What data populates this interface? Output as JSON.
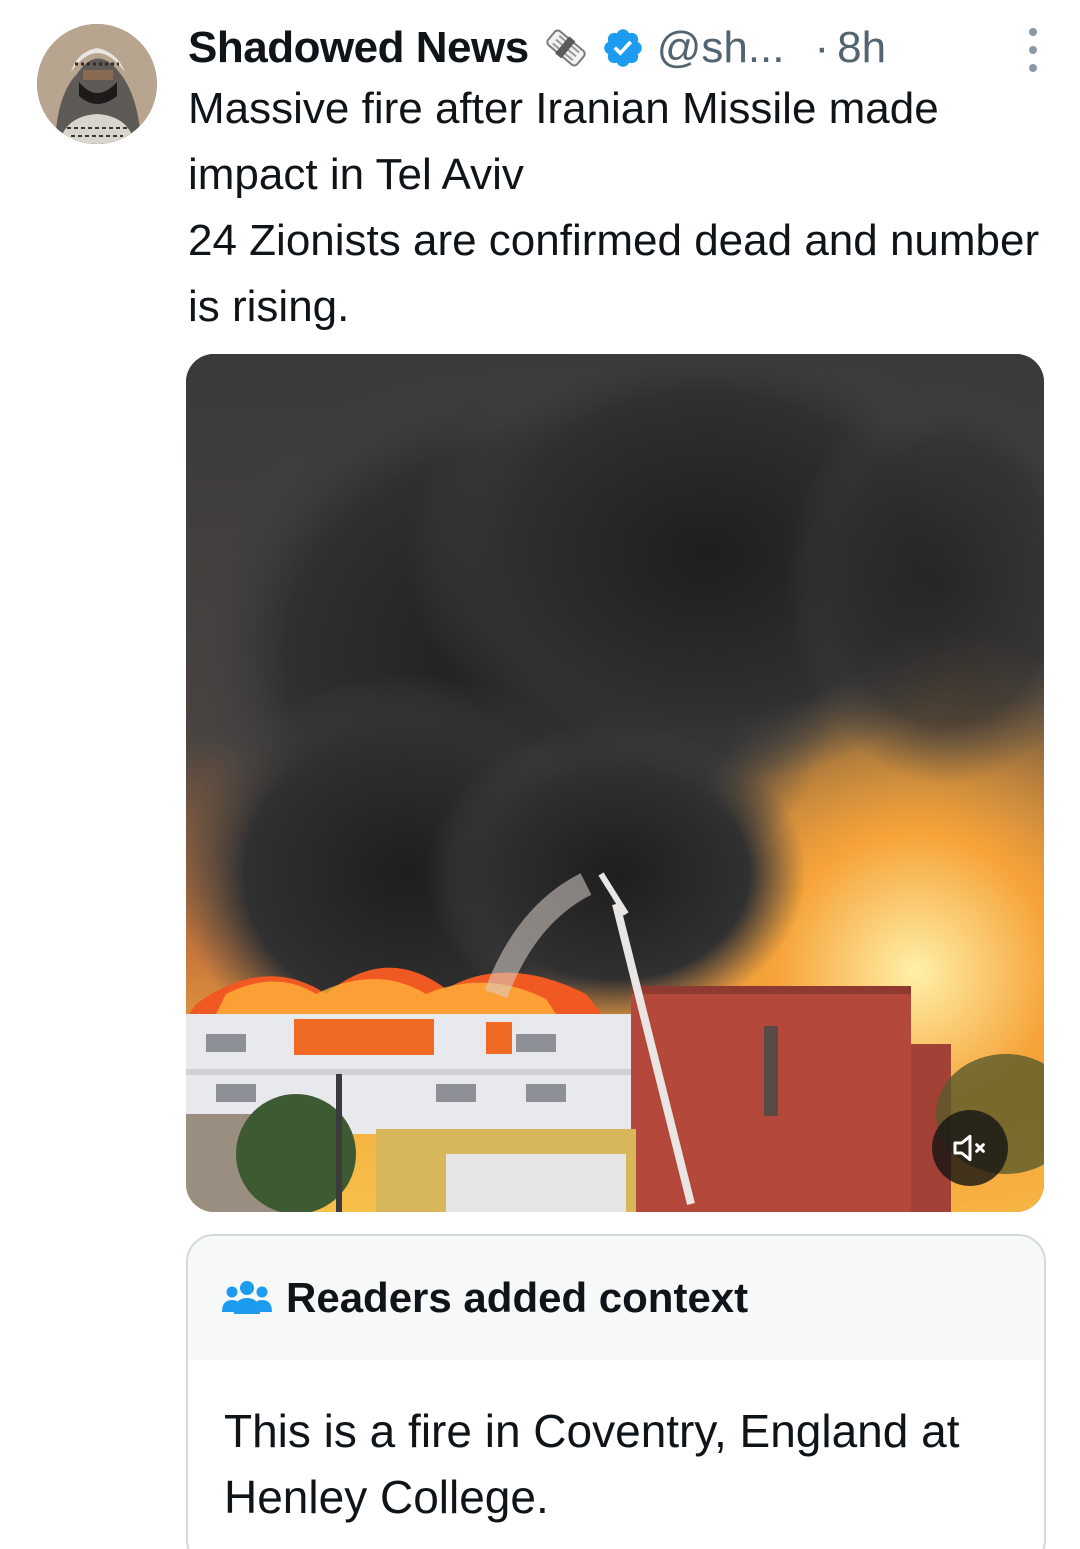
{
  "author": {
    "display_name": "Shadowed News",
    "name_emoji": "newspaper-roll-icon",
    "verified": true,
    "handle": "@sh...",
    "separator": "·",
    "time": "8h"
  },
  "tweet": {
    "lines": [
      "Massive fire after Iranian Missile made impact in Tel Aviv",
      "24 Zionists are confirmed dead and number is rising."
    ]
  },
  "media": {
    "type": "video",
    "description_icon": "mute-icon"
  },
  "context_note": {
    "title": "Readers added context",
    "body": "This is a fire in Coventry, England at Henley College."
  },
  "colors": {
    "text": "#0f1419",
    "secondary": "#536471",
    "verified_blue": "#1d9bf0",
    "card_border": "#cfd9de",
    "card_header_bg": "#f7f9f9"
  }
}
